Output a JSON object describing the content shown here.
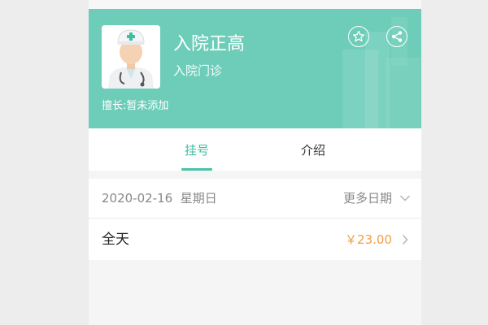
{
  "doctor": {
    "name": "入院正高",
    "department": "入院门诊",
    "specialty": "擅长:暂未添加"
  },
  "tabs": [
    {
      "label": "挂号",
      "active": true
    },
    {
      "label": "介绍",
      "active": false
    }
  ],
  "schedule": {
    "date": "2020-02-16",
    "weekday": "星期日",
    "more_dates_label": "更多日期"
  },
  "slot": {
    "label": "全天",
    "price": "￥23.00"
  },
  "icons": {
    "favorite": "star-icon",
    "share": "share-icon",
    "more_dates": "chevron-down-icon",
    "slot_arrow": "chevron-right-icon"
  },
  "colors": {
    "header": "#6ecdb9",
    "tab_active": "#3cbfa2",
    "price": "#f1a048"
  }
}
